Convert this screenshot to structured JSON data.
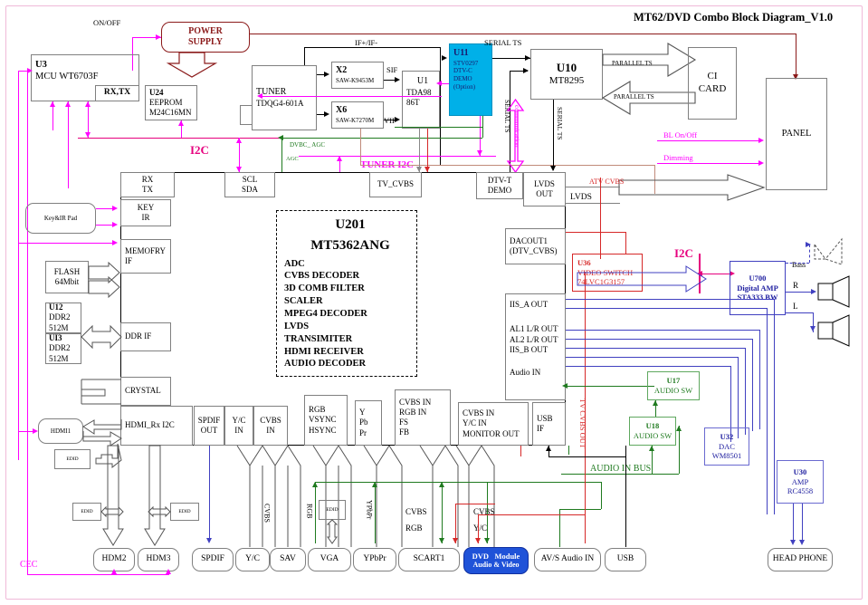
{
  "title": "MT62/DVD Combo Block Diagram_V1.0",
  "labels": {
    "on_off": "ON/OFF",
    "if_pm": "IF+/IF-",
    "sif": "SIF",
    "vif": "VIF",
    "serial_ts": "SERIAL TS",
    "parallel_ts": "PARALLEL TS",
    "communication": "communication",
    "bl_onoff": "BL On/Off",
    "dimming": "Dimming",
    "i2c": "I2C",
    "i2c2": "I2C",
    "tuner_i2c": "TUNER I2C",
    "dvbc_agc": "DVBC_ AGC",
    "agc": "AGC",
    "tv_cvbs": "TV_CVBS",
    "atv_cvbs": "ATV CVBS",
    "lvds": "LVDS",
    "tv_cvbs_out": "TV CVBS OUT",
    "audio_in_bus": "AUDIO IN BUS",
    "cec": "CEC",
    "bass": "Bass",
    "right": "R",
    "left": "L",
    "edid": "EDID",
    "cvbs": "CVBS",
    "rgb": "RGB",
    "ypbpr": "YPbPr",
    "cvbs_rgb_1": "CVBS",
    "cvbs_rgb_2": "RGB",
    "cvbs_yc_1": "CVBS",
    "cvbs_yc_2": "Y/C"
  },
  "blocks": {
    "power_supply": {
      "l1": "POWER",
      "l2": "SUPPLY"
    },
    "mcu": {
      "l1": "U3",
      "l2": "MCU WT6703F",
      "sub": "RX,TX"
    },
    "eeprom": {
      "l1": "U24",
      "l2": "EEPROM",
      "l3": "M24C16MN"
    },
    "tuner": {
      "l1": "TUNER",
      "l2": "TDQG4-601A"
    },
    "x2": {
      "l1": "X2",
      "l2": "SAW-K9453M"
    },
    "x6": {
      "l1": "X6",
      "l2": "SAW-K7270M"
    },
    "u1": {
      "l1": "U1",
      "l2": "TDA98",
      "l3": "86T"
    },
    "u11": {
      "l1": "U11",
      "l2": "STV0297",
      "l3": "DTV-C",
      "l4": "DEMO",
      "l5": "(Option)"
    },
    "u10": {
      "l1": "U10",
      "l2": "MT8295"
    },
    "ci_card": {
      "l1": "CI",
      "l2": "CARD"
    },
    "panel": {
      "l1": "PANEL"
    },
    "key_ir_pad": {
      "l1": "Key&IR Pad"
    },
    "flash": {
      "l1": "FLASH",
      "l2": "64Mbit"
    },
    "u12": {
      "l1": "U12",
      "l2": "DDR2",
      "l3": "512M"
    },
    "u13": {
      "l1": "UI3",
      "l2": "DDR2",
      "l3": "512M"
    },
    "hdmi1": {
      "l1": "HDMI1"
    },
    "u201": {
      "l1": "U201",
      "l2": "MT5362ANG",
      "features": [
        "ADC",
        "CVBS DECODER",
        "3D COMB FILTER",
        "SCALER",
        "MPEG4 DECODER",
        "LVDS",
        "TRANSIMITER",
        "HDMI RECEIVER",
        "AUDIO DECODER"
      ]
    },
    "u36": {
      "l1": "U36",
      "l2": "VIDEO SWITCH",
      "l3": "74LVC1G3157"
    },
    "u700": {
      "l1": "U700",
      "l2": "Digital AMP",
      "l3": "STA333 BW"
    },
    "u17": {
      "l1": "U17",
      "l2": "AUDIO SW"
    },
    "u18": {
      "l1": "U18",
      "l2": "AUDIO SW"
    },
    "u32": {
      "l1": "U32",
      "l2": "DAC",
      "l3": "WM8501"
    },
    "u30": {
      "l1": "U30",
      "l2": "AMP",
      "l3": "RC4558"
    },
    "dvd_module": {
      "l1": "DVD",
      "l2": "Module",
      "l3": "Audio & Video"
    },
    "head_phone": {
      "l1": "HEAD PHONE"
    }
  },
  "pins": {
    "rx_tx": [
      "RX",
      "TX"
    ],
    "scl_sda": [
      "SCL",
      "SDA"
    ],
    "key_ir": [
      "KEY",
      "IR"
    ],
    "memory_if": [
      "MEMOFRY",
      "IF"
    ],
    "ddr_if": [
      "DDR IF"
    ],
    "crystal": [
      "CRYSTAL"
    ],
    "hdmi_rx_i2c": [
      "HDMI_Rx I2C"
    ],
    "tv_cvbs_pin": [
      "TV_CVBS"
    ],
    "dtv_t_demo": [
      "DTV-T",
      "DEMO"
    ],
    "lvds_out": [
      "LVDS",
      "OUT"
    ],
    "dacout1": [
      "DACOUT1",
      "(DTV_CVBS)"
    ],
    "audio_outs": [
      "IIS_A OUT",
      "AL1 L/R OUT",
      "AL2 L/R OUT",
      "IIS_B OUT",
      "Audio IN"
    ],
    "spdif_out": [
      "SPDIF",
      "OUT"
    ],
    "yc_in": [
      "Y/C",
      "IN"
    ],
    "cvbs_in": [
      "CVBS",
      "IN"
    ],
    "rgb_sync": [
      "RGB",
      "VSYNC",
      "HSYNC"
    ],
    "ypbpr_pin": [
      "Y",
      "Pb",
      "Pr"
    ],
    "cvbs_rgb_fs_fb": [
      "CVBS IN",
      "RGB IN",
      "FS",
      "FB"
    ],
    "cvbs_yc_mon": [
      "CVBS IN",
      "Y/C IN",
      "MONITOR OUT"
    ],
    "usb_if": [
      "USB",
      "IF"
    ]
  },
  "connectors": [
    "HDM2",
    "HDM3",
    "SPDIF",
    "Y/C",
    "SAV",
    "VGA",
    "YPbPr",
    "SCART1",
    "AV/S Audio IN",
    "USB"
  ],
  "colors": {
    "magenta": "#ff00ff",
    "crimson": "#e6007e",
    "green": "#1f7a1f",
    "blue": "#4040c0",
    "red": "#d62828",
    "dark_red": "#8b1a1a",
    "cyan_block": "#00b0e8",
    "dvd_blue": "#1f52d8",
    "frame_pink": "#f0b9d8"
  }
}
